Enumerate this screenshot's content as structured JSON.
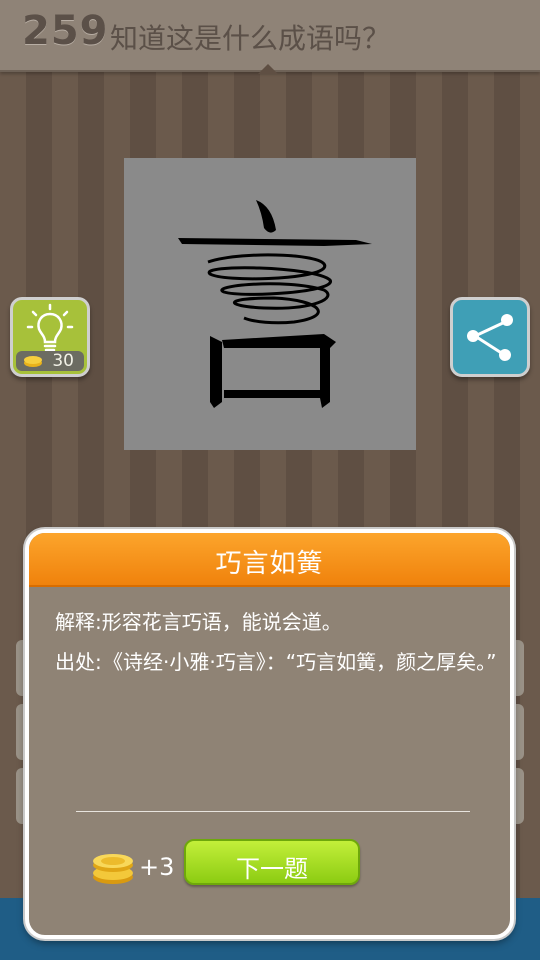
{
  "header": {
    "level": "259",
    "question": "知道这是什么成语吗？"
  },
  "puzzle": {
    "character": "言",
    "overlay_icon": "spring-coil-icon"
  },
  "hint_button": {
    "icon": "lightbulb-icon",
    "cost": "30"
  },
  "share_button": {
    "icon": "share-icon"
  },
  "dialog": {
    "title": "巧言如簧",
    "definition": "解释:形容花言巧语，能说会道。",
    "source_label": "出处:",
    "source_text": "《诗经·小雅·巧言》：“巧言如簧，颜之厚矣。”",
    "reward": "+3",
    "next_button": "下一题"
  },
  "colors": {
    "header": "#8f8377",
    "dialog_header": "#f7940f",
    "dialog_body": "#8f8375",
    "next_button": "#a9de24",
    "hint_button": "#a7c13a",
    "share_button": "#3f9fb6"
  }
}
